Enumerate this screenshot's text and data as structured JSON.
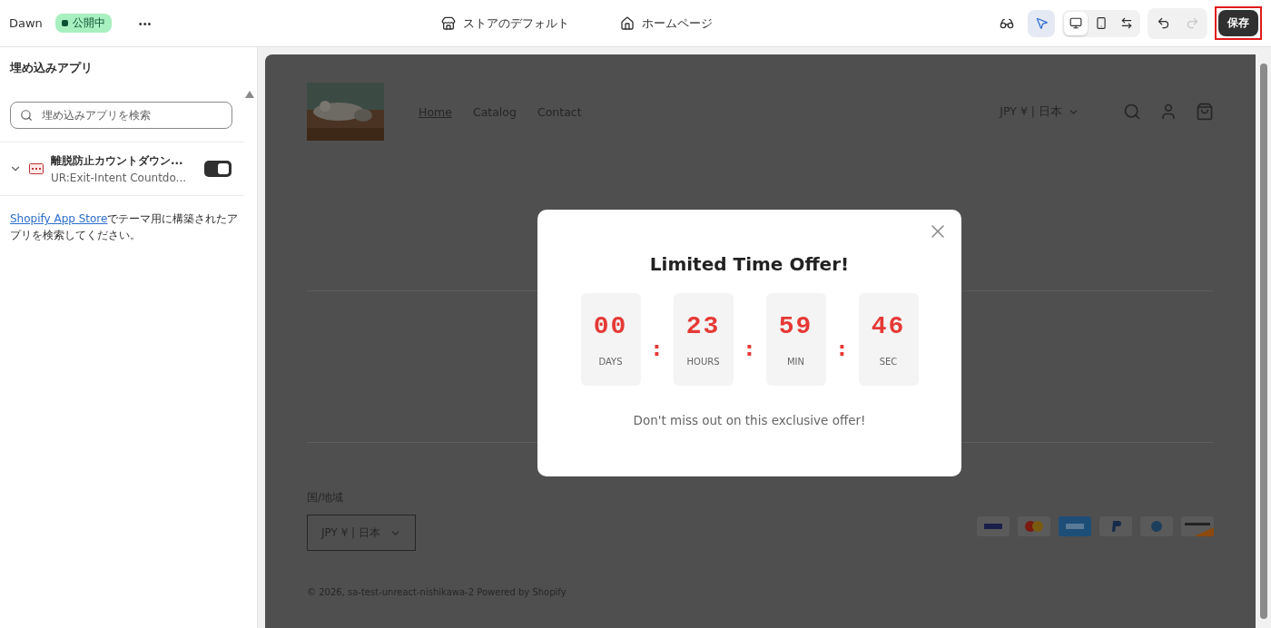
{
  "topbar": {
    "theme_name": "Dawn",
    "status": "公開中",
    "more": "•••",
    "center_links": [
      {
        "kind": "store",
        "label": "ストアのデフォルト"
      },
      {
        "kind": "home",
        "label": "ホームページ"
      }
    ],
    "inspector": {
      "selected": true
    },
    "devices": [
      {
        "kind": "desktop",
        "selected": true
      },
      {
        "kind": "mobile",
        "selected": false
      },
      {
        "kind": "fullwidth",
        "selected": false
      }
    ],
    "undo": {
      "disabled": false
    },
    "redo": {
      "disabled": true
    },
    "save": {
      "label": "保存",
      "highlighted": true
    }
  },
  "sidebar": {
    "title": "埋め込みアプリ",
    "search": {
      "placeholder": "埋め込みアプリを検索"
    },
    "apps": [
      {
        "name": "離脱防止カウントダウン...",
        "subtitle": "UR:Exit-Intent Countdo...",
        "on": true,
        "expanded": false
      }
    ],
    "note_link": "Shopify App Store",
    "note": "でテーマ用に構築されたアプリを検索してください。"
  },
  "store": {
    "nav": [
      {
        "label": "Home",
        "selected": true
      },
      {
        "label": "Catalog",
        "selected": false
      },
      {
        "label": "Contact",
        "selected": false
      }
    ],
    "currency": "JPY ¥ | 日本",
    "footer": {
      "region_label": "国/地域",
      "region_value": "JPY ¥ | 日本",
      "payments": [
        {
          "kind": "visa"
        },
        {
          "kind": "mastercard"
        },
        {
          "kind": "amex"
        },
        {
          "kind": "paypal"
        },
        {
          "kind": "diners"
        },
        {
          "kind": "discover"
        }
      ],
      "copyright": "© 2026, sa-test-unreact-nishikawa-2 Powered by Shopify"
    }
  },
  "popup": {
    "title": "Limited Time Offer!",
    "separator": ":",
    "units": [
      {
        "value": "00",
        "label": "DAYS"
      },
      {
        "value": "23",
        "label": "HOURS"
      },
      {
        "value": "59",
        "label": "MIN"
      },
      {
        "value": "46",
        "label": "SEC"
      }
    ],
    "message": "Don't miss out on this exclusive offer!"
  }
}
